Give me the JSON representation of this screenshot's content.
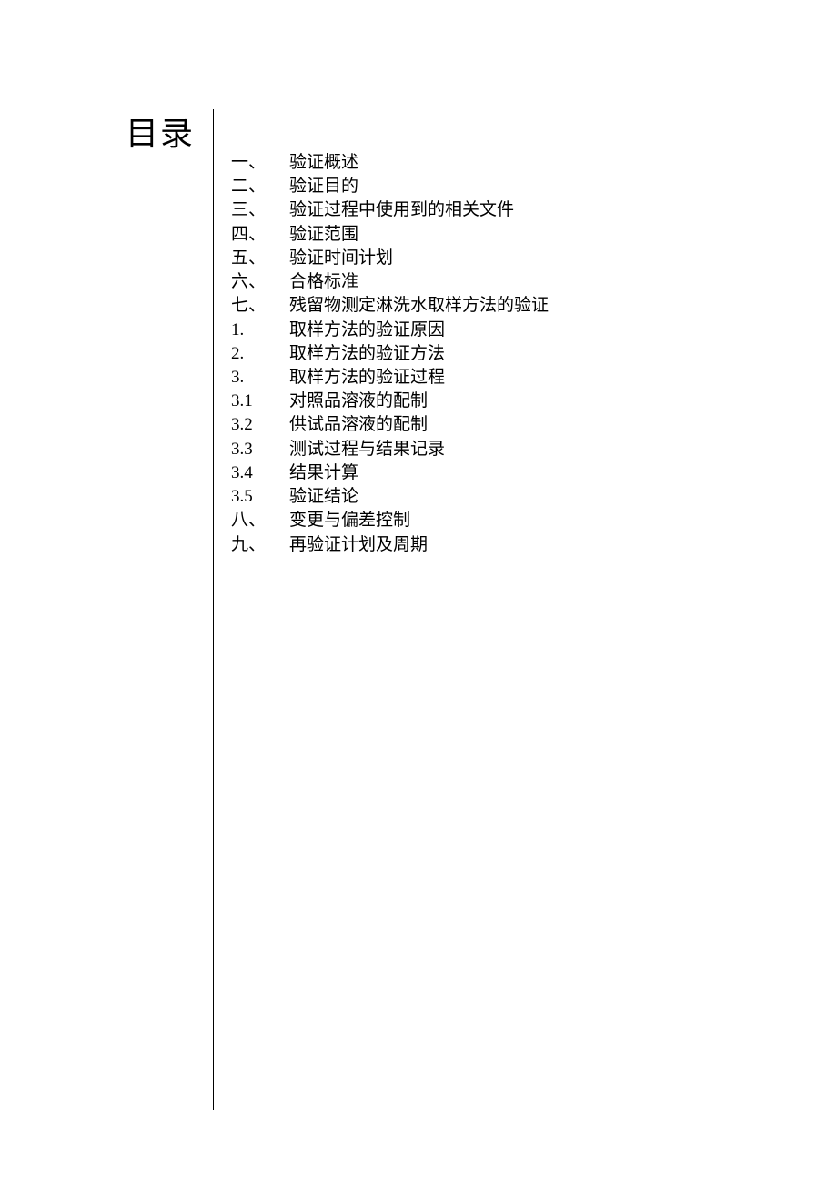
{
  "title": "目录",
  "toc": [
    {
      "number": "一、",
      "text": "验证概述"
    },
    {
      "number": "二、",
      "text": "验证目的"
    },
    {
      "number": "三、",
      "text": "验证过程中使用到的相关文件"
    },
    {
      "number": "四、",
      "text": "验证范围"
    },
    {
      "number": "五、",
      "text": "验证时间计划"
    },
    {
      "number": "六、",
      "text": "合格标准"
    },
    {
      "number": "七、",
      "text": "残留物测定淋洗水取样方法的验证"
    },
    {
      "number": "1.",
      "text": "取样方法的验证原因"
    },
    {
      "number": "2.",
      "text": "取样方法的验证方法"
    },
    {
      "number": "3.",
      "text": "取样方法的验证过程"
    },
    {
      "number": "3.1",
      "text": "对照品溶液的配制"
    },
    {
      "number": "3.2",
      "text": "供试品溶液的配制"
    },
    {
      "number": "3.3",
      "text": "测试过程与结果记录"
    },
    {
      "number": "3.4",
      "text": "结果计算"
    },
    {
      "number": "3.5",
      "text": "验证结论"
    },
    {
      "number": "八、",
      "text": "变更与偏差控制"
    },
    {
      "number": "九、",
      "text": "再验证计划及周期"
    }
  ]
}
